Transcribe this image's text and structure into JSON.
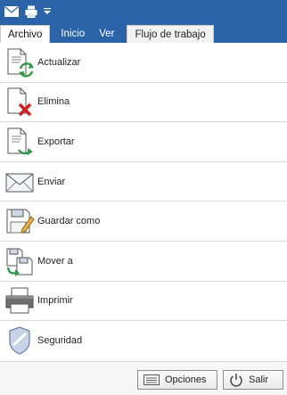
{
  "quick_access": {
    "icons": [
      "envelope-icon",
      "printer-icon",
      "dropdown-arrow-icon"
    ]
  },
  "tabs": [
    {
      "label": "Archivo",
      "active": true
    },
    {
      "label": "Inicio",
      "active": false
    },
    {
      "label": "Ver",
      "active": false
    },
    {
      "label": "Flujo de trabajo",
      "active": false
    }
  ],
  "menu": {
    "items": [
      {
        "label": "Actualizar",
        "icon": "document-refresh-icon"
      },
      {
        "label": "Elimina",
        "icon": "document-delete-icon"
      },
      {
        "label": "Exportar",
        "icon": "document-export-icon"
      },
      {
        "label": "Enviar",
        "icon": "envelope-icon"
      },
      {
        "label": "Guardar como",
        "icon": "save-as-icon"
      },
      {
        "label": "Mover a",
        "icon": "move-to-icon"
      },
      {
        "label": "Imprimir",
        "icon": "printer-icon"
      },
      {
        "label": "Seguridad",
        "icon": "shield-icon"
      }
    ]
  },
  "footer": {
    "options_label": "Opciones",
    "exit_label": "Salir"
  },
  "colors": {
    "ribbon": "#2b63a9",
    "green_arrow": "#2e9a46",
    "red_x": "#d02020"
  }
}
